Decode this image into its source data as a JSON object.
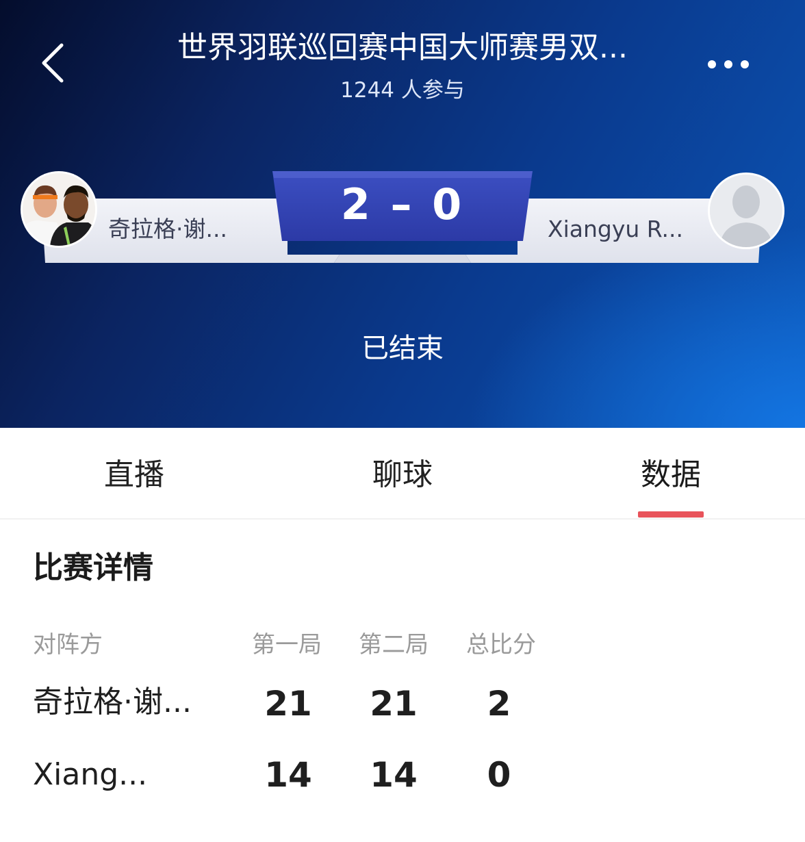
{
  "header": {
    "title": "世界羽联巡回赛中国大师赛男双...",
    "participants": "1244 人参与",
    "back_icon": "chevron-left-icon",
    "more_icon": "more-horizontal-icon"
  },
  "match": {
    "team_left": "奇拉格·谢...",
    "team_right": "Xiangyu R...",
    "score": "2 – 0",
    "status": "已结束"
  },
  "tabs": [
    {
      "label": "直播"
    },
    {
      "label": "聊球"
    },
    {
      "label": "数据"
    }
  ],
  "active_tab": "数据",
  "details": {
    "title": "比赛详情",
    "columns": [
      "对阵方",
      "第一局",
      "第二局",
      "总比分"
    ],
    "rows": [
      {
        "name": "奇拉格·谢...",
        "game1": "21",
        "game2": "21",
        "total": "2"
      },
      {
        "name": "Xiang...",
        "game1": "14",
        "game2": "14",
        "total": "0"
      }
    ]
  },
  "colors": {
    "accent": "#e8535a",
    "score_panel": "#2e3fae",
    "hero_dark": "#040d2c",
    "hero_light": "#0c57b9"
  }
}
